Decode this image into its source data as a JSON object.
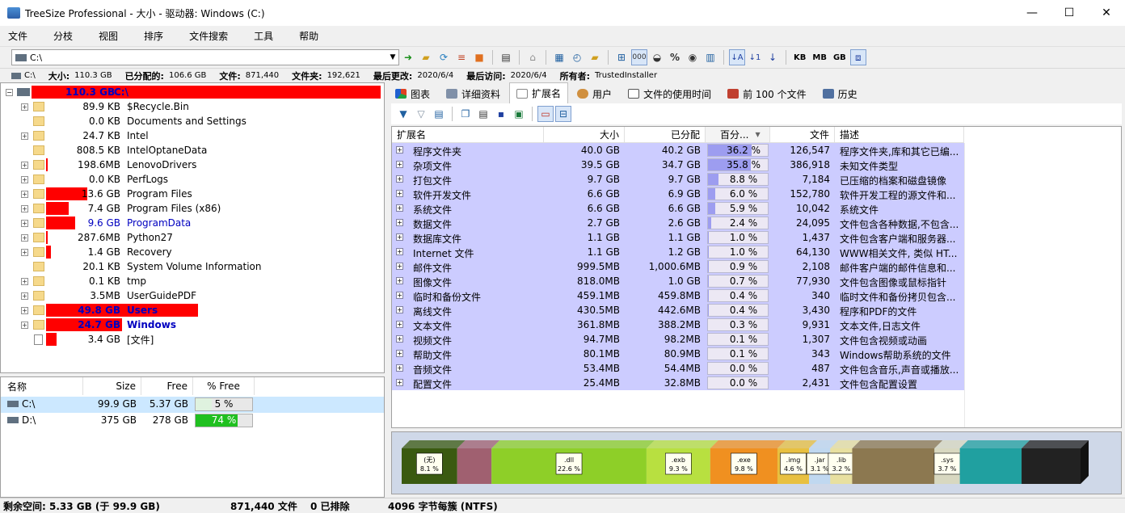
{
  "window": {
    "title": "TreeSize Professional - 大小 - 驱动器: Windows (C:)",
    "minimize": "—",
    "maximize": "☐",
    "close": "✕"
  },
  "menu": [
    "文件",
    "分枝",
    "视图",
    "排序",
    "文件搜索",
    "工具",
    "帮助"
  ],
  "toolbar": {
    "path": "C:\\",
    "units": [
      "KB",
      "MB",
      "GB"
    ],
    "percent_icon": "%"
  },
  "info": {
    "drive": "C:\\",
    "size_label": "大小:",
    "size": "110.3 GB",
    "alloc_label": "已分配的:",
    "alloc": "106.6 GB",
    "files_label": "文件:",
    "files": "871,440",
    "folders_label": "文件夹:",
    "folders": "192,621",
    "modified_label": "最后更改:",
    "modified": "2020/6/4",
    "accessed_label": "最后访问:",
    "accessed": "2020/6/4",
    "owner_label": "所有者:",
    "owner": "TrustedInstaller"
  },
  "tree": {
    "root": {
      "size": "110.3 GB",
      "name": "C:\\"
    },
    "items": [
      {
        "size": "89.9 KB",
        "name": "$Recycle.Bin",
        "bar": 0,
        "blue": false,
        "bold": false
      },
      {
        "size": "0.0 KB",
        "name": "Documents and Settings",
        "bar": 0,
        "blue": false,
        "bold": false
      },
      {
        "size": "24.7 KB",
        "name": "Intel",
        "bar": 0,
        "blue": false,
        "bold": false
      },
      {
        "size": "808.5 KB",
        "name": "IntelOptaneData",
        "bar": 0,
        "blue": false,
        "bold": false
      },
      {
        "size": "198.6MB",
        "name": "LenovoDrivers",
        "bar": 0.01,
        "blue": false,
        "bold": false
      },
      {
        "size": "0.0 KB",
        "name": "PerfLogs",
        "bar": 0,
        "blue": false,
        "bold": false
      },
      {
        "size": "13.6 GB",
        "name": "Program Files",
        "bar": 0.27,
        "blue": false,
        "bold": false
      },
      {
        "size": "7.4 GB",
        "name": "Program Files (x86)",
        "bar": 0.15,
        "blue": false,
        "bold": false
      },
      {
        "size": "9.6 GB",
        "name": "ProgramData",
        "bar": 0.19,
        "blue": true,
        "bold": false
      },
      {
        "size": "287.6MB",
        "name": "Python27",
        "bar": 0.01,
        "blue": false,
        "bold": false
      },
      {
        "size": "1.4 GB",
        "name": "Recovery",
        "bar": 0.03,
        "blue": false,
        "bold": false
      },
      {
        "size": "20.1 KB",
        "name": "System Volume Information",
        "bar": 0,
        "blue": false,
        "bold": false
      },
      {
        "size": "0.1 KB",
        "name": "tmp",
        "bar": 0,
        "blue": false,
        "bold": false
      },
      {
        "size": "3.5MB",
        "name": "UserGuidePDF",
        "bar": 0,
        "blue": false,
        "bold": false
      },
      {
        "size": "49.8 GB",
        "name": "Users",
        "bar": 1.0,
        "blue": true,
        "bold": true
      },
      {
        "size": "24.7 GB",
        "name": "Windows",
        "bar": 0.5,
        "blue": true,
        "bold": true
      },
      {
        "size": "3.4 GB",
        "name": "[文件]",
        "bar": 0.07,
        "blue": false,
        "bold": false
      }
    ]
  },
  "drives": {
    "headers": [
      "名称",
      "Size",
      "Free",
      "% Free"
    ],
    "rows": [
      {
        "name": "C:\\",
        "size": "99.9 GB",
        "free": "5.37 GB",
        "pct": "5 %",
        "fill": 0.05
      },
      {
        "name": "D:\\",
        "size": "375 GB",
        "free": "278 GB",
        "pct": "74 %",
        "fill": 0.74
      }
    ]
  },
  "tabs": [
    "图表",
    "详细资料",
    "扩展名",
    "用户",
    "文件的使用时间",
    "前 100 个文件",
    "历史"
  ],
  "grid": {
    "headers": [
      "扩展名",
      "大小",
      "已分配",
      "百分...",
      "文件",
      "描述"
    ],
    "rows": [
      {
        "ext": "程序文件夹",
        "size": "40.0 GB",
        "alloc": "40.2 GB",
        "pct": "36.2 %",
        "p": 36.2,
        "files": "126,547",
        "desc": "程序文件夹,库和其它已编..."
      },
      {
        "ext": "杂项文件",
        "size": "39.5 GB",
        "alloc": "34.7 GB",
        "pct": "35.8 %",
        "p": 35.8,
        "files": "386,918",
        "desc": "未知文件类型"
      },
      {
        "ext": "打包文件",
        "size": "9.7 GB",
        "alloc": "9.7 GB",
        "pct": "8.8 %",
        "p": 8.8,
        "files": "7,184",
        "desc": "已压缩的档案和磁盘镜像"
      },
      {
        "ext": "软件开发文件",
        "size": "6.6 GB",
        "alloc": "6.9 GB",
        "pct": "6.0 %",
        "p": 6.0,
        "files": "152,780",
        "desc": "软件开发工程的源文件和..."
      },
      {
        "ext": "系统文件",
        "size": "6.6 GB",
        "alloc": "6.6 GB",
        "pct": "5.9 %",
        "p": 5.9,
        "files": "10,042",
        "desc": "系统文件"
      },
      {
        "ext": "数据文件",
        "size": "2.7 GB",
        "alloc": "2.6 GB",
        "pct": "2.4 %",
        "p": 2.4,
        "files": "24,095",
        "desc": "文件包含各种数据,不包含..."
      },
      {
        "ext": "数据库文件",
        "size": "1.1 GB",
        "alloc": "1.1 GB",
        "pct": "1.0 %",
        "p": 1.0,
        "files": "1,437",
        "desc": "文件包含客户端和服务器..."
      },
      {
        "ext": "Internet 文件",
        "size": "1.1 GB",
        "alloc": "1.2 GB",
        "pct": "1.0 %",
        "p": 1.0,
        "files": "64,130",
        "desc": "WWW相关文件, 类似 HT..."
      },
      {
        "ext": "邮件文件",
        "size": "999.5MB",
        "alloc": "1,000.6MB",
        "pct": "0.9 %",
        "p": 0.9,
        "files": "2,108",
        "desc": "邮件客户端的邮件信息和..."
      },
      {
        "ext": "图像文件",
        "size": "818.0MB",
        "alloc": "1.0 GB",
        "pct": "0.7 %",
        "p": 0.7,
        "files": "77,930",
        "desc": "文件包含图像或鼠标指针"
      },
      {
        "ext": "临时和备份文件",
        "size": "459.1MB",
        "alloc": "459.8MB",
        "pct": "0.4 %",
        "p": 0.4,
        "files": "340",
        "desc": "临时文件和备份拷贝包含..."
      },
      {
        "ext": "离线文件",
        "size": "430.5MB",
        "alloc": "442.6MB",
        "pct": "0.4 %",
        "p": 0.4,
        "files": "3,430",
        "desc": "程序和PDF的文件"
      },
      {
        "ext": "文本文件",
        "size": "361.8MB",
        "alloc": "388.2MB",
        "pct": "0.3 %",
        "p": 0.3,
        "files": "9,931",
        "desc": "文本文件,日志文件"
      },
      {
        "ext": "视频文件",
        "size": "94.7MB",
        "alloc": "98.2MB",
        "pct": "0.1 %",
        "p": 0.1,
        "files": "1,307",
        "desc": "文件包含视频或动画"
      },
      {
        "ext": "帮助文件",
        "size": "80.1MB",
        "alloc": "80.9MB",
        "pct": "0.1 %",
        "p": 0.1,
        "files": "343",
        "desc": "Windows帮助系统的文件"
      },
      {
        "ext": "音频文件",
        "size": "53.4MB",
        "alloc": "54.4MB",
        "pct": "0.0 %",
        "p": 0.0,
        "files": "487",
        "desc": "文件包含音乐,声音或播放..."
      },
      {
        "ext": "配置文件",
        "size": "25.4MB",
        "alloc": "32.8MB",
        "pct": "0.0 %",
        "p": 0.0,
        "files": "2,431",
        "desc": "文件包含配置设置"
      }
    ]
  },
  "stack": {
    "segments": [
      {
        "label": "(无)",
        "pct": "8.1 %",
        "w": 8.1,
        "color": "#3a5a10"
      },
      {
        "label": "",
        "pct": "",
        "w": 5.0,
        "color": "#a06070"
      },
      {
        "label": ".dll",
        "pct": "22.6 %",
        "w": 22.6,
        "color": "#8ecf28"
      },
      {
        "label": ".exb",
        "pct": "9.3 %",
        "w": 9.3,
        "color": "#b8e040"
      },
      {
        "label": ".exe",
        "pct": "9.8 %",
        "w": 9.8,
        "color": "#f09020"
      },
      {
        "label": ".img",
        "pct": "4.6 %",
        "w": 4.6,
        "color": "#e8c040"
      },
      {
        "label": ".jar",
        "pct": "3.1 %",
        "w": 3.1,
        "color": "#c0d8f0"
      },
      {
        "label": ".lib",
        "pct": "3.2 %",
        "w": 3.2,
        "color": "#e8e0a0"
      },
      {
        "label": "",
        "pct": "",
        "w": 12.0,
        "color": "#8c7850"
      },
      {
        "label": ".sys",
        "pct": "3.7 %",
        "w": 3.7,
        "color": "#d8d8c0"
      },
      {
        "label": "",
        "pct": "",
        "w": 9.0,
        "color": "#20a0a0"
      },
      {
        "label": "",
        "pct": "",
        "w": 8.6,
        "color": "#222222"
      }
    ]
  },
  "status": {
    "free": "剩余空间: 5.33 GB  (于 99.9 GB)",
    "files": "871,440  文件",
    "excluded": "0 已排除",
    "cluster": "4096 字节每簇 (NTFS)"
  }
}
